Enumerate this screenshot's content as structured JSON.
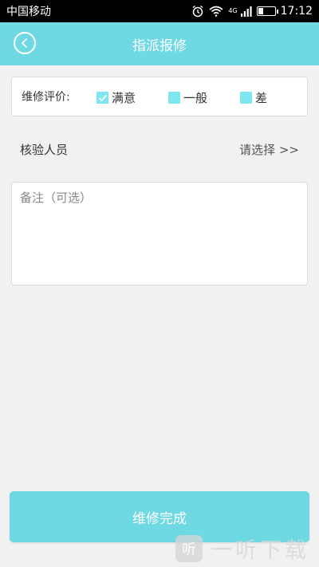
{
  "status_bar": {
    "carrier": "中国移动",
    "network": "4G",
    "time": "17:12",
    "battery_level": 0.3
  },
  "nav": {
    "title": "指派报修",
    "back_icon": "chevron-left-circle-icon"
  },
  "rating": {
    "label": "维修评价:",
    "options": [
      {
        "label": "满意",
        "checked": true
      },
      {
        "label": "一般",
        "checked": false
      },
      {
        "label": "差",
        "checked": false
      }
    ],
    "accent_color": "#7de6f0"
  },
  "inspector": {
    "label": "核验人员",
    "value": "请选择 >>"
  },
  "remark": {
    "placeholder": "备注（可选）",
    "value": ""
  },
  "actions": {
    "complete_label": "维修完成"
  },
  "watermark": {
    "logo_glyph": "听",
    "text": "一听下载"
  },
  "colors": {
    "primary": "#6ed8e3",
    "background": "#f1f1f1"
  }
}
